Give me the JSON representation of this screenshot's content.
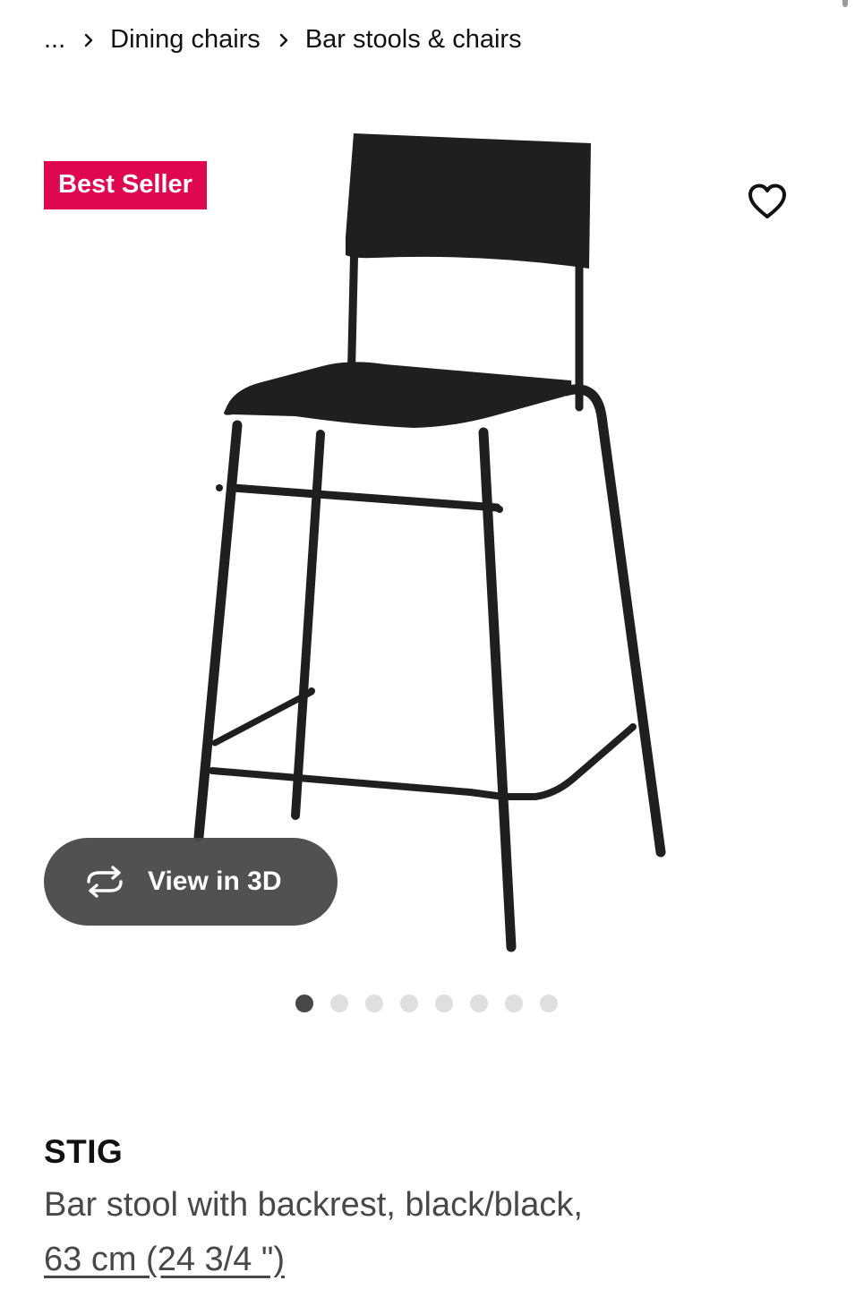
{
  "breadcrumb": {
    "ellipsis": "...",
    "items": [
      {
        "label": "Dining chairs"
      },
      {
        "label": "Bar stools & chairs"
      }
    ]
  },
  "badge": {
    "label": "Best Seller",
    "color": "#e00751"
  },
  "favorite": {
    "icon": "heart-outline-icon"
  },
  "view_3d": {
    "label": "View in 3D",
    "icon": "rotate-3d-icon"
  },
  "carousel": {
    "total": 8,
    "active_index": 0
  },
  "product": {
    "name": "STIG",
    "description": "Bar stool with backrest, black/black,",
    "size": "63 cm (24 3/4 \")"
  }
}
